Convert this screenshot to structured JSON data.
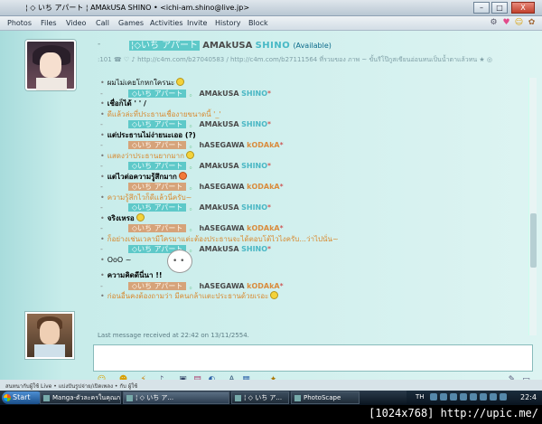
{
  "window": {
    "title": "¦ ◇ いち アパート ¦ AMAkUSA SHINO • <ichi-am.shino@live.jp>",
    "controls": {
      "minimize": "–",
      "maximize": "□",
      "close": "X"
    }
  },
  "menu": {
    "items": [
      "Photos",
      "Files",
      "Video",
      "Call",
      "Games",
      "Activities",
      "Invite",
      "History",
      "Block"
    ],
    "icons": [
      "settings-icon",
      "heart-icon",
      "smile-icon",
      "pet-icon"
    ]
  },
  "contact": {
    "name_prefix": "¦◇いち アパート",
    "name_main": "AMAkUSA",
    "name_accent": "SHINO",
    "status": "(Available)",
    "personal_message": ":101 ☎ ♡ ♪ http://c4m.com/b27040583 / http://c4m.com/b27111564 ที่รวมของ ภาพ ~ ขั้นรีโป๊กูสเขียนอ่อนทนเป็นน้ำตาแล้วทน ★ ◎"
  },
  "conversation": [
    {
      "kind": "msg",
      "style": "black",
      "text": "ผมไม่เคยโกหกใครนะ",
      "emoticon": true
    },
    {
      "kind": "nick",
      "who": "shino"
    },
    {
      "kind": "msg",
      "style": "bold",
      "text": "เชื่อก็ได้ ' ' /"
    },
    {
      "kind": "msg",
      "style": "orange",
      "text": "ดีแล้วล่ะที่ประธานเชื่องายขนาดนี้ '_'"
    },
    {
      "kind": "nick",
      "who": "shino"
    },
    {
      "kind": "msg",
      "style": "bold",
      "text": "แต่ประธานไม่ง่ายนะเออ (?)"
    },
    {
      "kind": "nick",
      "who": "kodaka"
    },
    {
      "kind": "msg",
      "style": "orange",
      "text": "แสดงว่าประธานยากมาก",
      "emoticon": true
    },
    {
      "kind": "nick",
      "who": "shino"
    },
    {
      "kind": "msg",
      "style": "bold",
      "text": "แต่ไวต่อความรู้สึกมาก",
      "emoticon": true,
      "emoticon_color": "red"
    },
    {
      "kind": "nick",
      "who": "kodaka"
    },
    {
      "kind": "msg",
      "style": "orange",
      "text": "ความรู้สึกไวก็ดีแล้วนี่ครับ~"
    },
    {
      "kind": "nick",
      "who": "shino"
    },
    {
      "kind": "msg",
      "style": "bold",
      "text": "จริงเหรอ",
      "emoticon": true
    },
    {
      "kind": "nick",
      "who": "kodaka"
    },
    {
      "kind": "msg",
      "style": "orange",
      "text": "ก็อย่างเช่นเวลามีใครมาแต่ะต้องประธานจะได้ตอบโต้ไวไงครับ...ว่าไปนั่น~"
    },
    {
      "kind": "nick",
      "who": "shino"
    },
    {
      "kind": "msg",
      "style": "black",
      "text": "OoO ~"
    },
    {
      "kind": "msg",
      "style": "bold",
      "text": "ความคิดดีนี่นา !!"
    },
    {
      "kind": "nick",
      "who": "kodaka"
    },
    {
      "kind": "msg",
      "style": "orange",
      "text": "ก่อนอื่นคงต้องถามว่า มีคนกล้าแตะประธานด้วยเรอะ",
      "emoticon": true
    }
  ],
  "nicks": {
    "shino": {
      "tag": "◇いち アパート",
      "first": "AMAkUSA",
      "last": "SHINO",
      "suffix": "*"
    },
    "kodaka": {
      "tag": "◇いち アパート",
      "first": "hASEGAWA",
      "last": "kODAkA",
      "suffix": "*"
    }
  },
  "last_received": "Last message received at 22:42 on 13/11/2554.",
  "compose": {
    "placeholder": "",
    "toolbar_icons": [
      "emoticon-icon",
      "wink-icon",
      "nudge-icon",
      "voice-clip-icon",
      "image-icon",
      "gif-icon",
      "background-icon",
      "font-icon",
      "color-icon",
      "sticker-icon"
    ]
  },
  "status_bar": "สนทนากับผู้ใช้ Live • แบ่งปันรูปจ่าย/เปิดเพลง • กับ ผู้ใช้",
  "taskbar": {
    "start": "Start",
    "tasks": [
      "Manga-ตัวละครในคุณภาพ...",
      "¦ ◇ いち ア...",
      "¦ ◇ いち ア...",
      "PhotoScape"
    ],
    "lang": "TH",
    "clock": "22:4"
  },
  "watermark": "[1024x768] http://upic.me/"
}
